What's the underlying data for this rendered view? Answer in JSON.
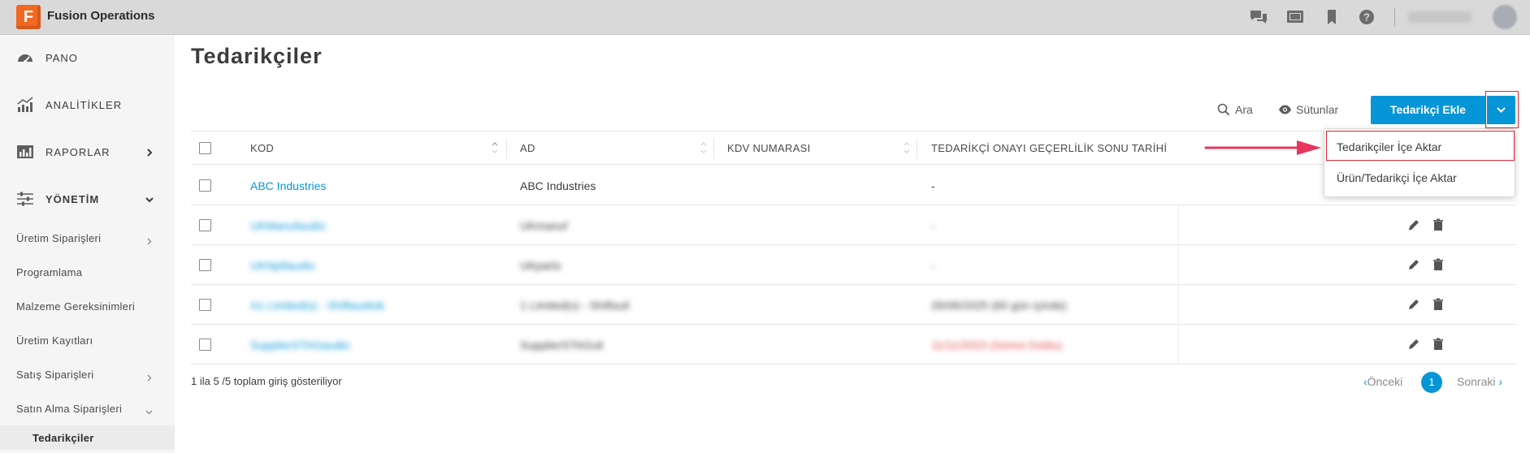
{
  "app": {
    "title": "Fusion Operations",
    "logo_letter": "F",
    "brand_color": "#f26722",
    "accent_color": "#0696d7"
  },
  "topbar": {
    "icons": [
      "chat-icon",
      "display-icon",
      "bookmark-icon",
      "help-icon"
    ]
  },
  "sidebar": {
    "main_items": [
      {
        "label": "PANO",
        "icon": "dashboard-icon"
      },
      {
        "label": "ANALİTİKLER",
        "icon": "analytics-icon"
      },
      {
        "label": "RAPORLAR",
        "icon": "reports-icon"
      },
      {
        "label": "YÖNETİM",
        "icon": "sliders-icon"
      }
    ],
    "sub_items": [
      {
        "label": "Üretim Siparişleri"
      },
      {
        "label": "Programlama"
      },
      {
        "label": "Malzeme Gereksinimleri"
      },
      {
        "label": "Üretim Kayıtları"
      },
      {
        "label": "Satış Siparişleri"
      },
      {
        "label": "Satın Alma Siparişleri"
      },
      {
        "label": "Tedarikçiler"
      }
    ]
  },
  "page": {
    "title": "Tedarikçiler"
  },
  "toolbar": {
    "search_label": "Ara",
    "columns_label": "Sütunlar",
    "add_label": "Tedarikçi Ekle"
  },
  "dropdown": {
    "items": [
      {
        "label": "Tedarikçiler İçe Aktar"
      },
      {
        "label": "Ürün/Tedarikçi İçe Aktar"
      }
    ]
  },
  "table": {
    "columns": [
      "KOD",
      "AD",
      "KDV NUMARASI",
      "TEDARİKÇİ ONAYI GEÇERLİLİK SONU TARİHİ"
    ],
    "rows": [
      {
        "code": "ABC Industries",
        "name": "ABC Industries",
        "vat": "",
        "expiry": "-"
      },
      {
        "code": "UKManufaudio",
        "name": "UKmanuf",
        "vat": "",
        "expiry": "-"
      },
      {
        "code": "UKNptfaudio",
        "name": "UKparts",
        "vat": "",
        "expiry": "-"
      },
      {
        "code": "A1 Limited(s) - Shiftaudiob",
        "name": "1 Limited(s) - Shiftsuli",
        "vat": "",
        "expiry": "26/06/2025 (60 gün içinde)"
      },
      {
        "code": "SupplierSTAGaudio",
        "name": "SupplierSTAGuli",
        "vat": "",
        "expiry": "11/11/2023 (Süresi Doldu)"
      }
    ]
  },
  "footer": {
    "info": "1 ila 5 /5 toplam giriş gösteriliyor",
    "prev": "Önceki",
    "next": "Sonraki",
    "page": "1"
  }
}
